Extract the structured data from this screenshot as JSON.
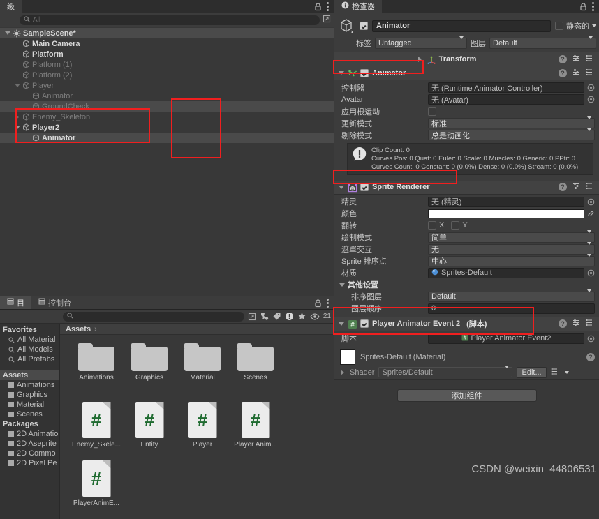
{
  "hierarchy": {
    "tab_label": "级",
    "search_placeholder": "All",
    "items": [
      {
        "label": "SampleScene*",
        "indent": 0,
        "kind": "scene",
        "expand": "down",
        "state": "bold",
        "selected": true
      },
      {
        "label": "Main Camera",
        "indent": 1,
        "kind": "object",
        "expand": "none",
        "state": "bold",
        "selected": false
      },
      {
        "label": "Platform",
        "indent": 1,
        "kind": "object",
        "expand": "none",
        "state": "bold",
        "selected": false
      },
      {
        "label": "Platform (1)",
        "indent": 1,
        "kind": "object",
        "expand": "none",
        "state": "dim",
        "selected": false
      },
      {
        "label": "Platform (2)",
        "indent": 1,
        "kind": "object",
        "expand": "none",
        "state": "dim",
        "selected": false
      },
      {
        "label": "Player",
        "indent": 1,
        "kind": "object",
        "expand": "down",
        "state": "dim",
        "selected": false
      },
      {
        "label": "Animator",
        "indent": 2,
        "kind": "object",
        "expand": "none",
        "state": "dim",
        "selected": false
      },
      {
        "label": "GroundCheck",
        "indent": 2,
        "kind": "object",
        "expand": "none",
        "state": "dim",
        "selected": true
      },
      {
        "label": "Enemy_Skeleton",
        "indent": 1,
        "kind": "object",
        "expand": "right",
        "state": "dim",
        "selected": false
      },
      {
        "label": "Player2",
        "indent": 1,
        "kind": "object",
        "expand": "down",
        "state": "bold",
        "selected": false
      },
      {
        "label": "Animator",
        "indent": 2,
        "kind": "object",
        "expand": "none",
        "state": "bold",
        "selected": true
      }
    ]
  },
  "project": {
    "tab_project_label": "目",
    "tab_console_label": "控制台",
    "search_placeholder": "",
    "eye_count": "21",
    "breadcrumb": "Assets",
    "breadcrumb_chevron": "›",
    "sidebar": [
      {
        "label": "Favorites",
        "type": "group",
        "highlight": false
      },
      {
        "label": "All Material",
        "type": "search"
      },
      {
        "label": "All Models",
        "type": "search"
      },
      {
        "label": "All Prefabs",
        "type": "search"
      },
      {
        "label": "",
        "type": "gap"
      },
      {
        "label": "Assets",
        "type": "group",
        "highlight": true
      },
      {
        "label": "Animations",
        "type": "folder"
      },
      {
        "label": "Graphics",
        "type": "folder"
      },
      {
        "label": "Material",
        "type": "folder"
      },
      {
        "label": "Scenes",
        "type": "folder"
      },
      {
        "label": "Packages",
        "type": "group",
        "highlight": false
      },
      {
        "label": "2D Animatio",
        "type": "folder"
      },
      {
        "label": "2D Aseprite",
        "type": "folder"
      },
      {
        "label": "2D Commo",
        "type": "folder"
      },
      {
        "label": "2D Pixel Pe",
        "type": "folder"
      }
    ],
    "assets": [
      {
        "label": "Animations",
        "type": "folder",
        "selected": false
      },
      {
        "label": "Graphics",
        "type": "folder",
        "selected": false
      },
      {
        "label": "Material",
        "type": "folder",
        "selected": false
      },
      {
        "label": "Scenes",
        "type": "folder",
        "selected": false
      },
      {
        "label": "Enemy_Skele...",
        "type": "script",
        "selected": false
      },
      {
        "label": "Entity",
        "type": "script",
        "selected": false
      },
      {
        "label": "Player",
        "type": "script",
        "selected": false
      },
      {
        "label": "Player Anim...",
        "type": "script",
        "selected": true
      },
      {
        "label": "PlayerAnimE...",
        "type": "script",
        "selected": false
      }
    ]
  },
  "inspector": {
    "tab_label": "检查器",
    "object_name": "Animator",
    "static_label": "静态的",
    "tag_label": "标签",
    "tag_value": "Untagged",
    "layer_label": "图层",
    "layer_value": "Default",
    "components": [
      {
        "name": "Transform",
        "icon": "transform-icon",
        "collapsed": true,
        "has_checkbox": false,
        "rows": []
      },
      {
        "name": "Animator",
        "icon": "animator-icon",
        "collapsed": false,
        "has_checkbox": true,
        "checked": true,
        "rows": [
          {
            "label": "控制器",
            "type": "objectfield",
            "value": "无 (Runtime Animator Controller)"
          },
          {
            "label": "Avatar",
            "type": "objectfield",
            "value": "无 (Avatar)"
          },
          {
            "label": "应用根运动",
            "type": "checkbox",
            "value": false
          },
          {
            "label": "更新模式",
            "type": "dropdown",
            "value": "标准"
          },
          {
            "label": "剔除模式",
            "type": "dropdown",
            "value": "总是动画化"
          }
        ],
        "info": [
          "Clip Count: 0",
          "Curves Pos: 0 Quat: 0 Euler: 0 Scale: 0 Muscles: 0 Generic: 0 PPtr: 0",
          "Curves Count: 0 Constant: 0 (0.0%) Dense: 0 (0.0%) Stream: 0 (0.0%)"
        ]
      },
      {
        "name": "Sprite Renderer",
        "icon": "sprite-renderer-icon",
        "collapsed": false,
        "has_checkbox": true,
        "checked": true,
        "rows": [
          {
            "label": "精灵",
            "type": "objectfield",
            "value": "无 (精灵)"
          },
          {
            "label": "颜色",
            "type": "colorfield",
            "value": "#FFFFFF"
          },
          {
            "label": "翻转",
            "type": "flip",
            "value": "X  Y",
            "flip_x_label": "X",
            "flip_y_label": "Y"
          },
          {
            "label": "绘制模式",
            "type": "dropdown",
            "value": "简单"
          },
          {
            "label": "遮罩交互",
            "type": "dropdown",
            "value": "无"
          },
          {
            "label": "Sprite 排序点",
            "type": "dropdown",
            "value": "中心"
          },
          {
            "label": "材质",
            "type": "materialfield",
            "value": "Sprites-Default"
          },
          {
            "label": "其他设置",
            "type": "subheader"
          },
          {
            "label": "排序图层",
            "type": "dropdown",
            "value": "Default",
            "indent": true
          },
          {
            "label": "图层顺序",
            "type": "text",
            "value": "0",
            "indent": true
          }
        ]
      },
      {
        "name": "Player Animator Event 2",
        "name_suffix": "(脚本)",
        "icon": "cs-script-icon",
        "collapsed": false,
        "has_checkbox": true,
        "checked": true,
        "rows": [
          {
            "label": "脚本",
            "type": "scriptfield",
            "value": "Player Animator Event2"
          }
        ]
      }
    ],
    "material_preview": {
      "title": "Sprites-Default (Material)",
      "shader_label": "Shader",
      "shader_value": "Sprites/Default",
      "edit_label": "Edit..."
    },
    "add_component_label": "添加组件"
  },
  "watermark": "CSDN @weixin_44806531",
  "colors": {
    "annotation": "#f01f1f",
    "panel": "#383838",
    "header": "#3c3c3c",
    "component_header": "#424242",
    "selection": "#4a4a4a",
    "script_green": "#1f6b30",
    "sprite_icon": "#b07fe0"
  }
}
